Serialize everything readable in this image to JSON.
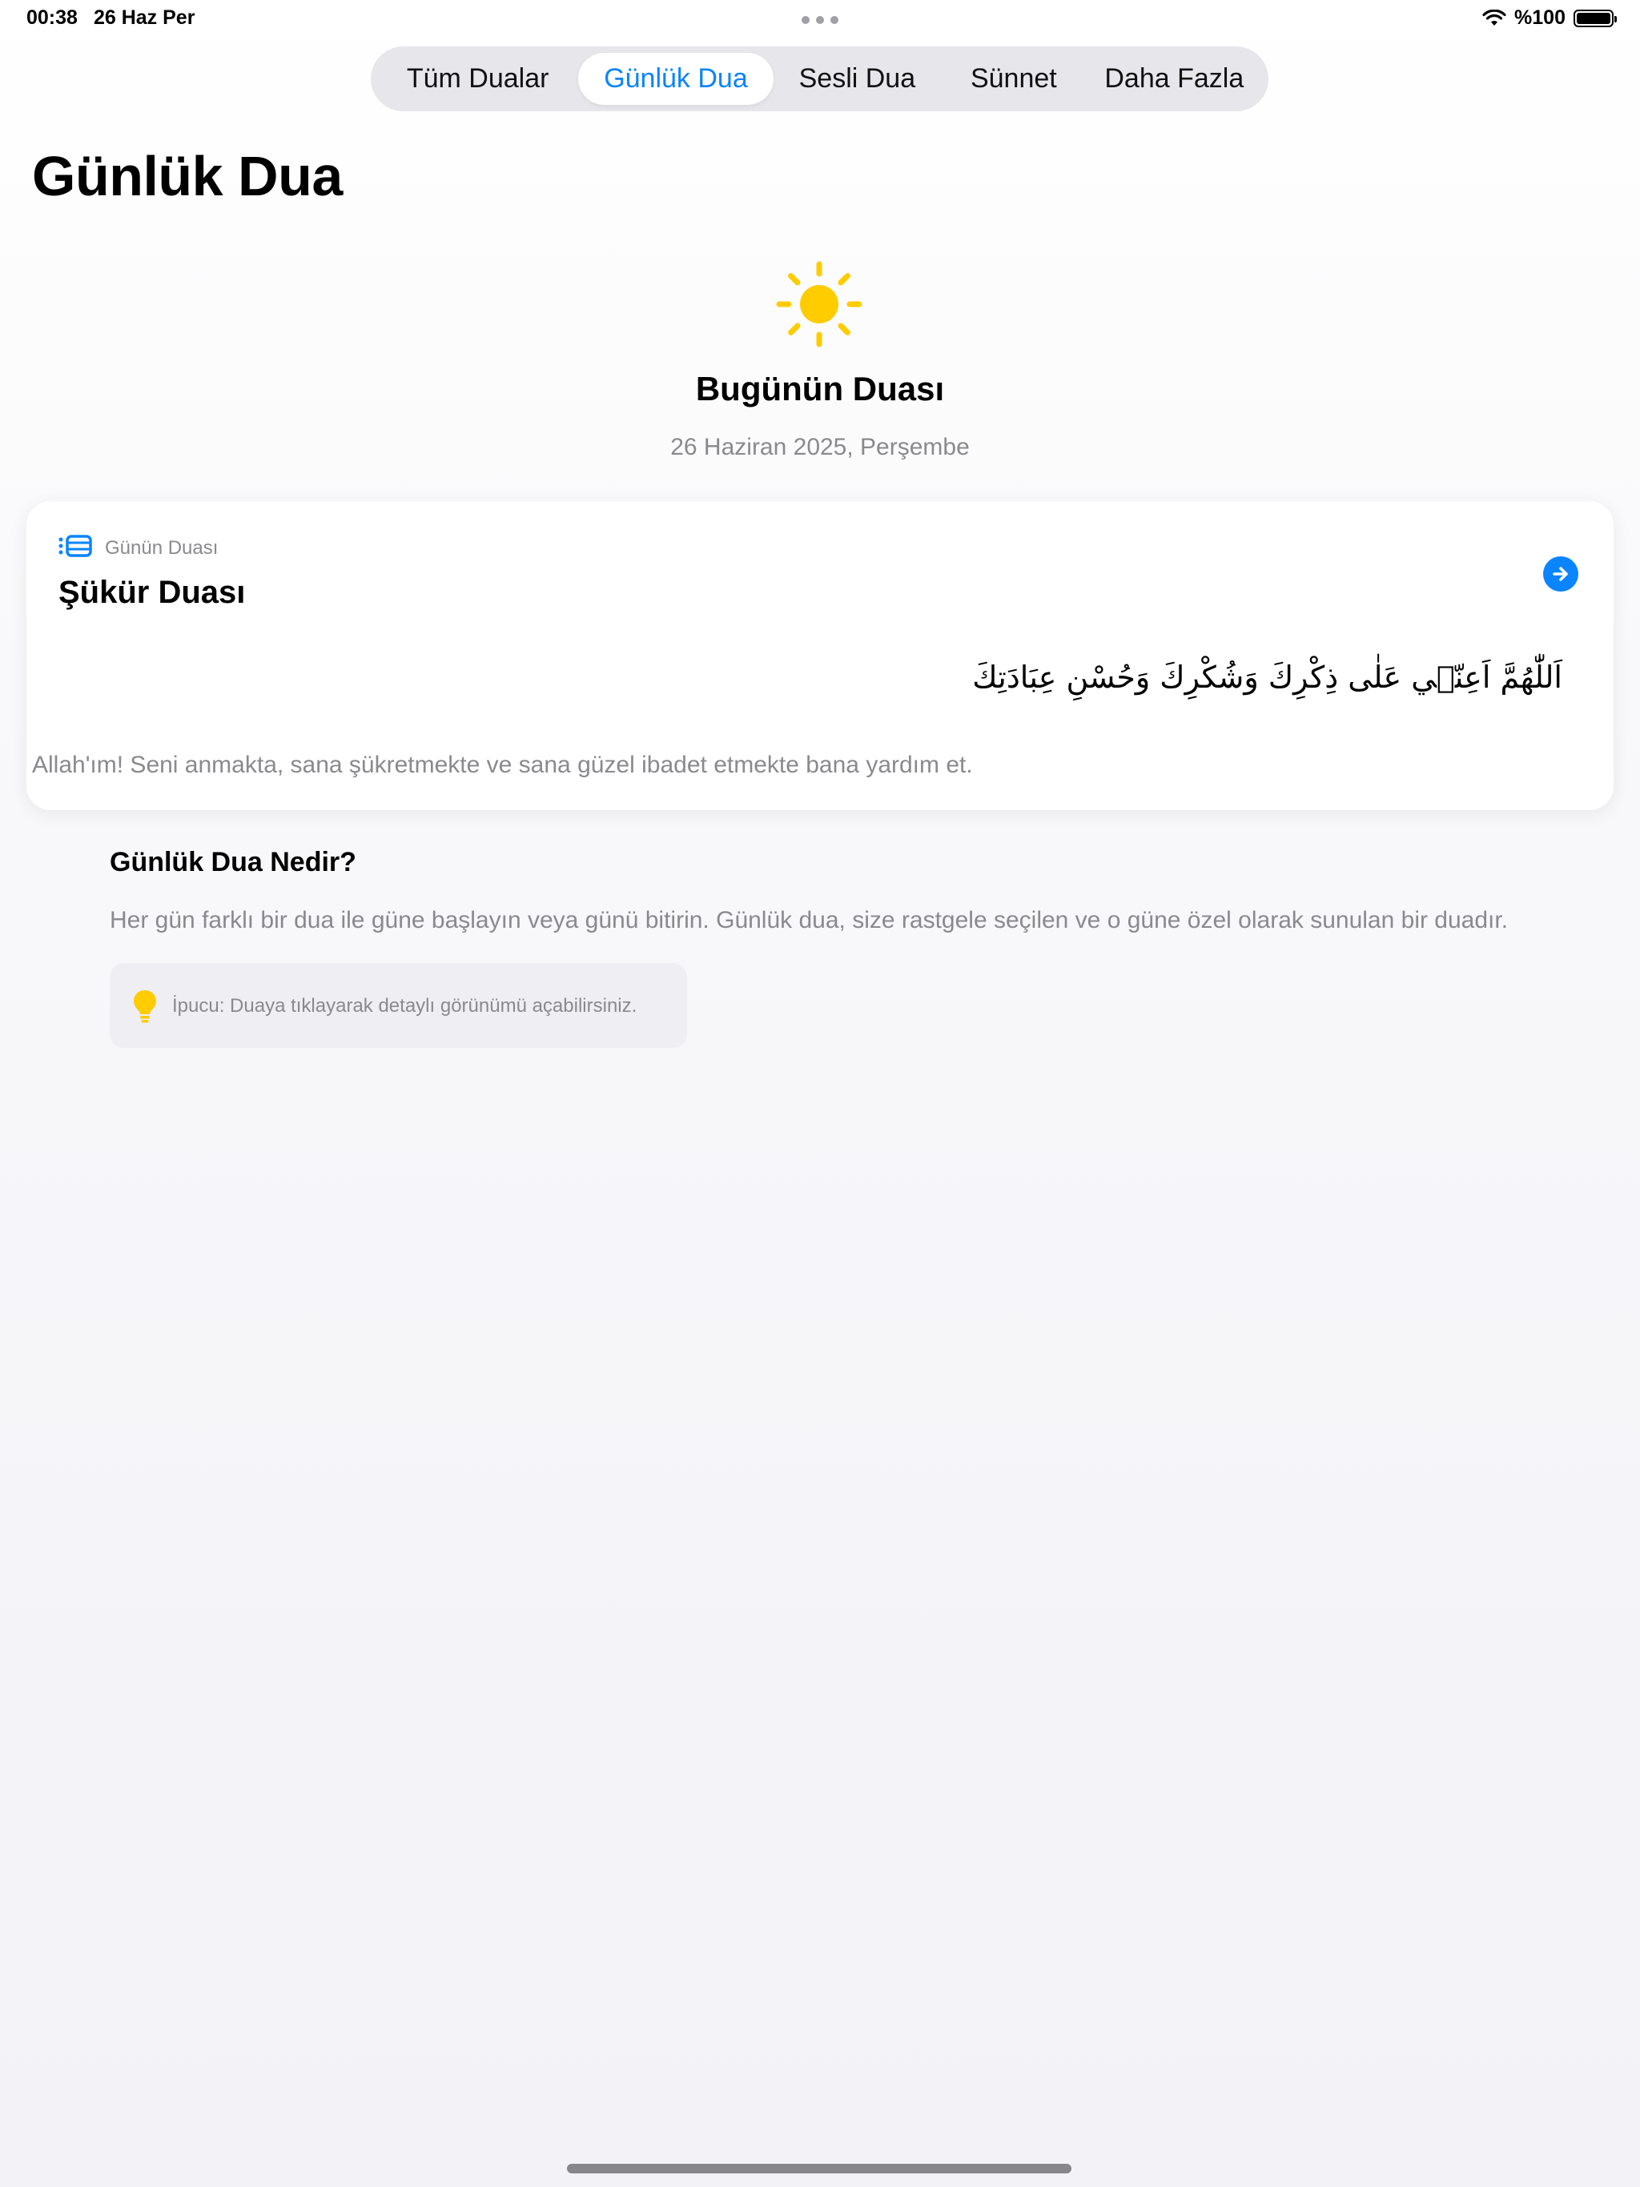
{
  "status_bar": {
    "time": "00:38",
    "date": "26 Haz Per",
    "battery": "%100",
    "icons": [
      "wifi-icon",
      "battery-icon",
      "more-dots-icon"
    ]
  },
  "tabs": [
    {
      "label": "Tüm Dualar",
      "active": false
    },
    {
      "label": "Günlük Dua",
      "active": true
    },
    {
      "label": "Sesli Dua",
      "active": false
    },
    {
      "label": "Sünnet",
      "active": false
    },
    {
      "label": "Daha Fazla",
      "active": false
    }
  ],
  "page": {
    "title": "Günlük Dua"
  },
  "hero": {
    "icon": "sun-icon",
    "title": "Bugünün Duası",
    "date": "26 Haziran 2025, Perşembe"
  },
  "card": {
    "label_icon": "list-icon",
    "label": "Günün Duası",
    "title": "Şükür Duası",
    "arabic": "اَللّٰهُمَّ اَعِنّ۪ي عَلٰى ذِكْرِكَ وَشُكْرِكَ وَحُسْنِ عِبَادَتِكَ",
    "translation": "Allah'ım! Seni anmakta, sana şükretmekte ve sana güzel ibadet etmekte bana yardım et.",
    "action_icon": "arrow-right-circle-icon"
  },
  "info": {
    "heading": "Günlük Dua Nedir?",
    "text": "Her gün farklı bir dua ile güne başlayın veya günü bitirin. Günlük dua, size rastgele seçilen ve o güne özel olarak sunulan bir duadır.",
    "tip_icon": "lightbulb-icon",
    "tip": "İpucu: Duaya tıklayarak detaylı görünümü açabilirsiniz."
  },
  "colors": {
    "accent": "#0a84ff",
    "sun": "#ffcc00",
    "secondary_text": "#8a8a8e",
    "tab_bar_bg": "#e6e6eb"
  }
}
